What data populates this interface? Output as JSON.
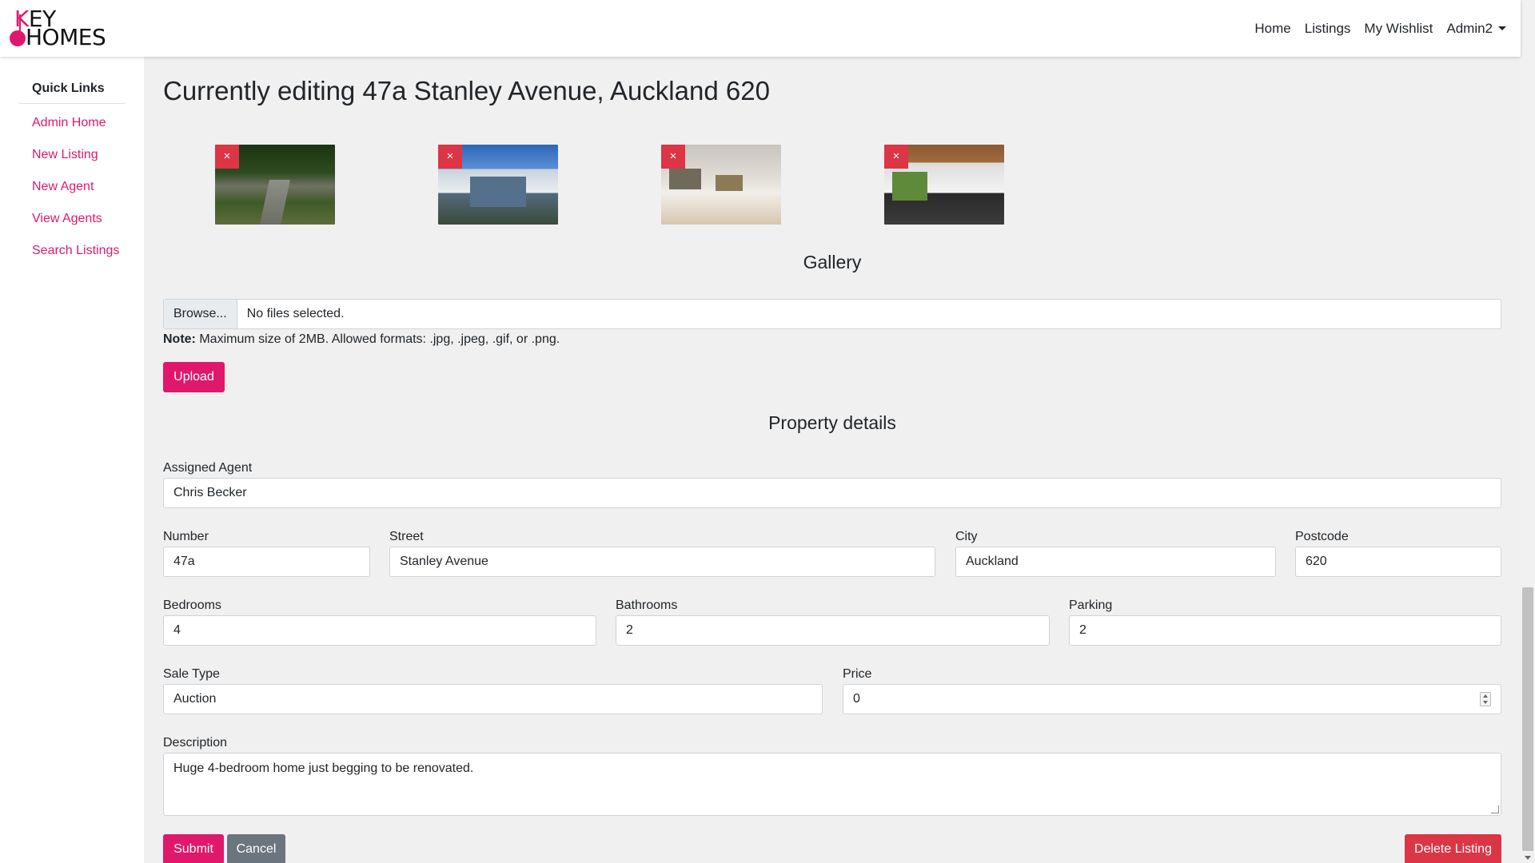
{
  "brand": {
    "line1_k": "K",
    "line1_rest": "EY",
    "line2": "HOMES"
  },
  "nav": {
    "home": "Home",
    "listings": "Listings",
    "wishlist": "My Wishlist",
    "user": "Admin2"
  },
  "sidebar": {
    "heading": "Quick Links",
    "items": [
      {
        "label": "Admin Home"
      },
      {
        "label": "New Listing"
      },
      {
        "label": "New Agent"
      },
      {
        "label": "View Agents"
      },
      {
        "label": "Search Listings"
      }
    ]
  },
  "page": {
    "title": "Currently editing 47a Stanley Avenue, Auckland 620"
  },
  "gallery": {
    "remove_glyph": "×",
    "title": "Gallery",
    "browse_label": "Browse...",
    "no_file": "No files selected.",
    "note_label": "Note:",
    "note_text": " Maximum size of 2MB. Allowed formats: .jpg, .jpeg, .gif, or .png.",
    "upload_label": "Upload"
  },
  "details": {
    "title": "Property details",
    "assigned_agent": {
      "label": "Assigned Agent",
      "value": "Chris Becker"
    },
    "number": {
      "label": "Number",
      "value": "47a"
    },
    "street": {
      "label": "Street",
      "value": "Stanley Avenue"
    },
    "city": {
      "label": "City",
      "value": "Auckland"
    },
    "postcode": {
      "label": "Postcode",
      "value": "620"
    },
    "bedrooms": {
      "label": "Bedrooms",
      "value": "4"
    },
    "bathrooms": {
      "label": "Bathrooms",
      "value": "2"
    },
    "parking": {
      "label": "Parking",
      "value": "2"
    },
    "sale_type": {
      "label": "Sale Type",
      "value": "Auction"
    },
    "price": {
      "label": "Price",
      "value": "0"
    },
    "description": {
      "label": "Description",
      "value": "Huge 4-bedroom home just begging to be renovated."
    }
  },
  "actions": {
    "submit": "Submit",
    "cancel": "Cancel",
    "delete": "Delete Listing"
  },
  "colors": {
    "accent": "#e0186c",
    "danger": "#dc3545",
    "secondary": "#6c757d",
    "page_bg": "#f0f0f0"
  }
}
